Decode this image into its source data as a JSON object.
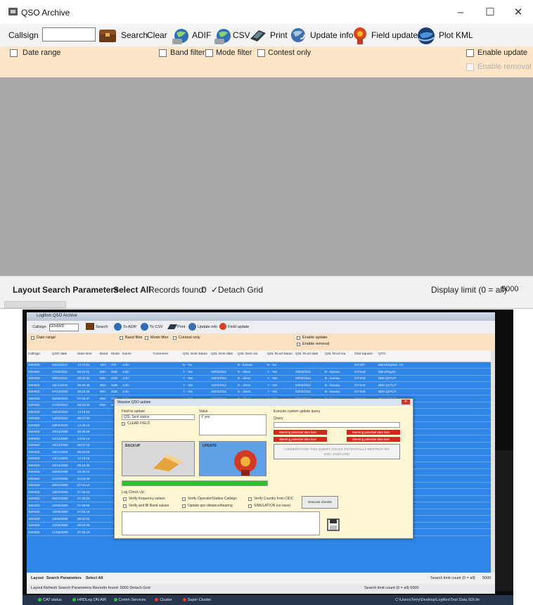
{
  "window": {
    "title": "QSO Archive",
    "controls": {
      "minimize": "–",
      "maximize": "☐",
      "close": "✕"
    }
  },
  "toolbar": {
    "callsign_label": "Callsign",
    "callsign_value": "",
    "search": "Search",
    "clear": "Clear",
    "adif": "ADIF",
    "csv": "CSV",
    "print": "Print",
    "update_info": "Update info",
    "field_update": "Field update",
    "plot_kml": "Plot KML"
  },
  "filters": {
    "date_range": "Date range",
    "band_filter": "Band filter",
    "mode_filter": "Mode filter",
    "contest_only": "Contest only",
    "enable_update": "Enable update",
    "enable_removal": "Enable removal"
  },
  "statusbar": {
    "layout": "Layout",
    "search_parameters": "Search Parameters",
    "select_all": "Select All",
    "records_found_label": "Records found:",
    "records_found_value": "0",
    "detach_grid": "Detach Grid",
    "display_limit_label": "Display limit (0 = all)",
    "display_limit_value": "5000"
  },
  "colors": {
    "filter_bg": "#fde5c7",
    "grid_bg": "#a9a9a9",
    "selected_row": "#2d86e8",
    "warning": "#d8261f"
  },
  "screenshot2": {
    "title": "Logifom QSO Archive",
    "toolbar": {
      "callsign_label": "Callsign",
      "callsign_value": "G0HWD",
      "search": "Search",
      "to_adif": "To ADIF",
      "to_csv": "To CSV",
      "print": "Print",
      "update_info": "Update info",
      "field_update": "Field update"
    },
    "filters": {
      "date_range": "Date range",
      "band_filter": "Band filter",
      "mode_filter": "Mode filter",
      "contest_only": "Contest only",
      "enable_update": "Enable update",
      "enable_removal": "Enable removal"
    },
    "columns": [
      "Callsign",
      "QSO date",
      "Start time",
      "Band",
      "Mode",
      "Name",
      "Comment",
      "QSL Sent status",
      "QSL Sent date",
      "QSL Sent via",
      "QSL Rcvd status",
      "QSL Rcvd date",
      "QSL Rcvd via",
      "Grid Square",
      "QTH"
    ],
    "rows": [
      [
        "G0HWD",
        "04/11/2012",
        "13:14:51",
        "15m",
        "CW",
        "John",
        "",
        "N - No",
        "",
        "B - bureau",
        "N - No",
        "",
        "",
        "IO74ZT",
        "Manchinghen, Co"
      ],
      [
        "G0HWD",
        "27/02/2011",
        "08:16:11",
        "80m",
        "SSB",
        "John",
        "",
        "Y - Yes",
        "15/03/2011",
        "D - direct",
        "Y - Yes",
        "03/03/2011",
        "B - bureau",
        "IO74AB",
        "Manchingen"
      ],
      [
        "G0HWD",
        "09/01/2011",
        "08:34:36",
        "80m",
        "SSB",
        "John",
        "",
        "Y - Yes",
        "15/03/2011",
        "D - direct",
        "Y - Yes",
        "03/03/2011",
        "B - bureau",
        "IO74AB",
        "BBS QSTUT"
      ],
      [
        "G0HWD",
        "15/11/2010",
        "08:40:38",
        "80m",
        "SSB",
        "John",
        "",
        "Y - Yes",
        "15/03/2011",
        "D - direct",
        "Y - Yes",
        "03/03/2011",
        "B - bureau",
        "IO74AB",
        "BBS QSTUT"
      ],
      [
        "G0HWD",
        "07/10/2010",
        "08:23:26",
        "80m",
        "SSB",
        "John",
        "",
        "Y - Yes",
        "15/03/2011",
        "D - direct",
        "Y - Yes",
        "03/03/2011",
        "B - bureau",
        "IO74AB",
        "BBS QSTUT"
      ],
      [
        "G0HWD",
        "05/03/2010",
        "07:50:37",
        "80m",
        "SSB",
        "John",
        "",
        "Y - Yes",
        "15/03/2011",
        "D - direct",
        "Y - Yes",
        "25/03/2011",
        "B - bureau",
        "IO74AB",
        "BBS QSTUT"
      ],
      [
        "G0HWD",
        "21/02/2010",
        "08:33:46",
        "80m",
        "SSB",
        "John",
        "",
        "Y - Yes",
        "15/03/2011",
        "D - direct",
        "Y - Yes",
        "15/03/2011",
        "B - bureau",
        "IO74AB",
        "BBS QSTUT"
      ],
      [
        "G0HWD",
        "16/02/2010",
        "14:19:23",
        "",
        "",
        "",
        "",
        "",
        "",
        "",
        "",
        "",
        "",
        "IO74AB",
        "BBS QSTUT"
      ],
      [
        "G0HWD",
        "14/02/2010",
        "08:27:00",
        "",
        "",
        "",
        "",
        "",
        "",
        "",
        "",
        "",
        "",
        "IO74AB",
        "BBS QSTUT"
      ],
      [
        "G0HWD",
        "10/02/2010",
        "14:30:15",
        "",
        "",
        "",
        "",
        "",
        "",
        "",
        "",
        "",
        "",
        "IO74AB",
        "BBS QSTUT"
      ],
      [
        "G0HWD",
        "20/12/2009",
        "08:35:59",
        "",
        "",
        "",
        "",
        "",
        "",
        "",
        "",
        "",
        "",
        "IO74AB",
        "BBS QSTUT"
      ],
      [
        "G0HWD",
        "12/12/2009",
        "14:02:14",
        "",
        "",
        "",
        "",
        "",
        "",
        "",
        "",
        "",
        "",
        "IO74AB",
        "BBS QSTUT"
      ],
      [
        "G0HWD",
        "15/12/2009",
        "08:07:19",
        "",
        "",
        "",
        "",
        "",
        "",
        "",
        "",
        "",
        "",
        "IO74AB",
        "BBS QSTUT"
      ],
      [
        "G0HWD",
        "15/11/2009",
        "08:24:08",
        "",
        "",
        "",
        "",
        "",
        "",
        "",
        "",
        "",
        "",
        "IO74AB",
        "BBS QSTUT"
      ],
      [
        "G0HWD",
        "14/11/2009",
        "12:16:44",
        "",
        "",
        "",
        "",
        "",
        "",
        "",
        "",
        "",
        "",
        "IO74AB",
        "BBS QSTUT"
      ],
      [
        "G0HWD",
        "20/10/2009",
        "08:18:35",
        "",
        "",
        "",
        "",
        "",
        "",
        "",
        "",
        "",
        "",
        "IO74AB",
        "BBS QSTUT"
      ],
      [
        "G0HWD",
        "26/08/2009",
        "23:35:14",
        "",
        "",
        "",
        "",
        "",
        "",
        "",
        "",
        "",
        "",
        "IO74AB",
        "BBS QSTUT"
      ],
      [
        "G0HWD",
        "21/07/2009",
        "21:03:29",
        "",
        "",
        "",
        "",
        "",
        "",
        "",
        "",
        "",
        "",
        "IO74AB",
        "BBS QSTUT"
      ],
      [
        "G0HWD",
        "20/07/2009",
        "07:02:14",
        "",
        "",
        "",
        "",
        "",
        "",
        "",
        "",
        "",
        "",
        "IO74AB",
        "BBS QSTUT"
      ],
      [
        "G0HWD",
        "16/07/2009",
        "07:36:43",
        "",
        "",
        "",
        "",
        "",
        "",
        "",
        "",
        "",
        "",
        "IO74AB",
        "BBS QSTUT"
      ],
      [
        "G0HWD",
        "05/07/2009",
        "07:30:53",
        "",
        "",
        "",
        "",
        "",
        "",
        "",
        "",
        "",
        "",
        "IO74AB",
        "BBS QSTUT"
      ],
      [
        "G0HWD",
        "22/06/2009",
        "07:09:09",
        "",
        "",
        "",
        "",
        "",
        "",
        "",
        "",
        "",
        "",
        "IO74AB",
        "BBS QSTUT"
      ],
      [
        "G0HWD",
        "15/06/2009",
        "07:05:18",
        "",
        "",
        "",
        "",
        "",
        "",
        "",
        "",
        "",
        "",
        "IO74AB",
        ""
      ],
      [
        "G0HWD",
        "13/06/2009",
        "08:32:01",
        "",
        "",
        "",
        "",
        "",
        "",
        "",
        "",
        "",
        "",
        "IO74AB",
        ""
      ],
      [
        "G0HWD",
        "12/06/2009",
        "06:52:26",
        "",
        "",
        "",
        "",
        "",
        "",
        "",
        "",
        "",
        "",
        "IO74AB",
        ""
      ],
      [
        "G0HWD",
        "21/05/2009",
        "07:05:23",
        "",
        "",
        "",
        "",
        "",
        "",
        "",
        "",
        "",
        "",
        "IO74AB",
        ""
      ]
    ],
    "dialog": {
      "title": "Massive QSO update",
      "field_to_update_label": "Field to update",
      "field_to_update_value": "QSL Sent status",
      "clear_field": "CLEAR FIELD",
      "value_label": "Value",
      "value_value": "Y yes",
      "custom_query_label": "Execute custom update query",
      "query_label": "Query",
      "warnings": [
        "Warning potential data loss",
        "Warning potential data loss",
        "Warning potential data loss",
        "Warning potential data loss"
      ],
      "understand_text": "I UNDERSTAND THIS QUERY COULD POTENTIALLY DESTROY MY LOG. EXECUTE!",
      "backup": "BACKUP",
      "update": "UPDATE",
      "progress": 1.0,
      "log_checkup_label": "Log Check Up",
      "checks": [
        "Verify frequency values",
        "Verify Operator/Station Callsign",
        "Verify Country from CIDC",
        "Verify and fill Band values",
        "Update qso distance/bearing",
        "SIMULATION (no save)"
      ],
      "execute_checks": "Execute checks"
    },
    "status": {
      "layout": "Layout",
      "search_parameters": "Search Parameters",
      "select_all": "Select All",
      "search_limit": "Search limit count (0 = all)",
      "search_limit_value": "5000"
    },
    "status2": {
      "text": "Layout Refresh Search Parameters  Records found: 5000  Detach Grid",
      "right": "Search limit count (0 = all)  5000"
    },
    "taskbar": [
      "CAT status",
      "HRDLog ON AIR",
      "Comm Services",
      "Cluster",
      "Super Cluster"
    ],
    "taskbar_right": "C:\\Users\\Terry\\Desktop\\Logfiles\\Test Data.SDLite"
  }
}
